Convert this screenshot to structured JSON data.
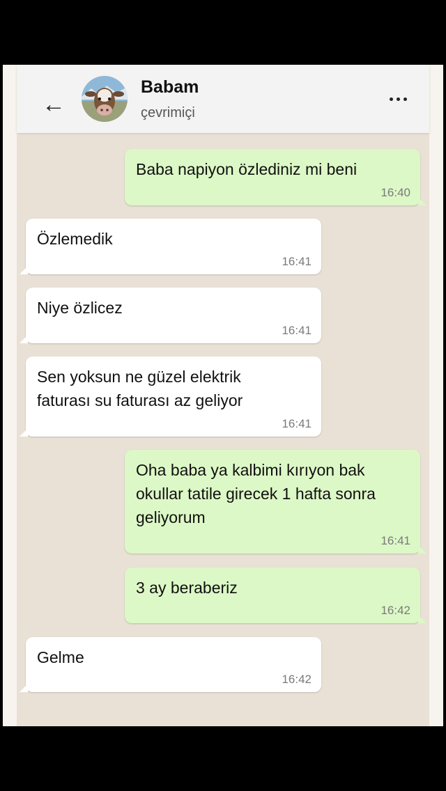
{
  "header": {
    "back_icon": "←",
    "contact_name": "Babam",
    "status": "çevrimiçi",
    "menu_icon": "more-vertical-dots"
  },
  "messages": [
    {
      "direction": "outgoing",
      "text": "Baba napiyon özlediniz mi beni",
      "time": "16:40"
    },
    {
      "direction": "incoming",
      "text": "Özlemedik",
      "time": "16:41"
    },
    {
      "direction": "incoming",
      "text": "Niye özlicez",
      "time": "16:41"
    },
    {
      "direction": "incoming",
      "text": "Sen yoksun ne güzel elektrik faturası su faturası az geliyor",
      "time": "16:41"
    },
    {
      "direction": "outgoing",
      "text": "Oha baba ya kalbimi kırıyon bak okullar tatile girecek 1 hafta sonra geliyorum",
      "time": "16:41"
    },
    {
      "direction": "outgoing",
      "text": "3 ay beraberiz",
      "time": "16:42"
    },
    {
      "direction": "incoming",
      "text": "Gelme",
      "time": "16:42"
    }
  ],
  "colors": {
    "outgoing_bubble": "#dcf8c6",
    "incoming_bubble": "#ffffff",
    "chat_background": "#e9e1d6",
    "header_background": "#f3f3f3"
  }
}
